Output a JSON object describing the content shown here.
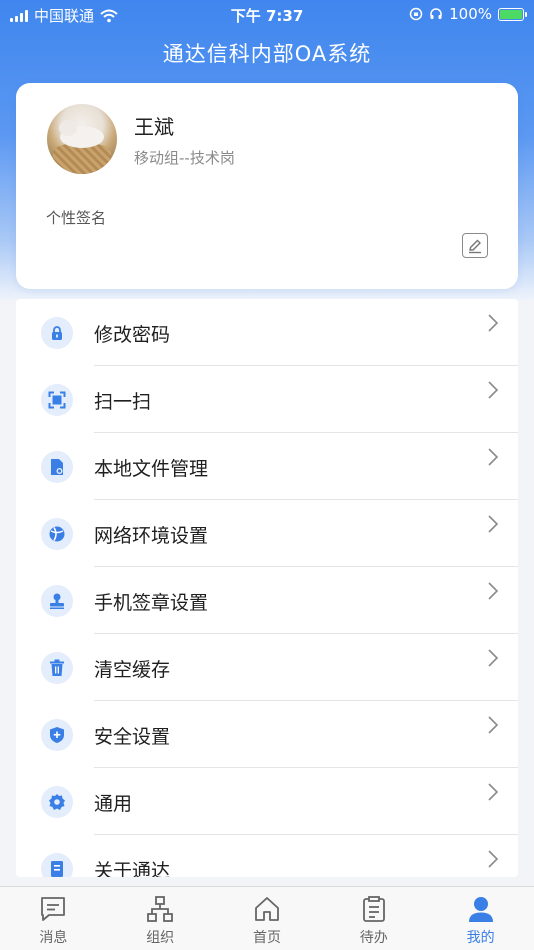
{
  "status_bar": {
    "carrier": "中国联通",
    "time": "下午 7:37",
    "battery": "100%",
    "battery_level": 1.0
  },
  "header": {
    "title": "通达信科内部OA系统"
  },
  "profile": {
    "name": "王斌",
    "department": "移动组--技术岗",
    "signature_label": "个性签名"
  },
  "menu": [
    {
      "label": "修改密码",
      "icon": "lock-icon"
    },
    {
      "label": "扫一扫",
      "icon": "scan-icon"
    },
    {
      "label": "本地文件管理",
      "icon": "file-icon"
    },
    {
      "label": "网络环境设置",
      "icon": "network-icon"
    },
    {
      "label": "手机签章设置",
      "icon": "stamp-icon"
    },
    {
      "label": "清空缓存",
      "icon": "trash-icon"
    },
    {
      "label": "安全设置",
      "icon": "shield-icon"
    },
    {
      "label": "通用",
      "icon": "gear-icon"
    },
    {
      "label": "关于通达",
      "icon": "info-doc-icon"
    }
  ],
  "tabs": [
    {
      "label": "消息",
      "icon": "message-icon",
      "active": false
    },
    {
      "label": "组织",
      "icon": "org-icon",
      "active": false
    },
    {
      "label": "首页",
      "icon": "home-icon",
      "active": false
    },
    {
      "label": "待办",
      "icon": "clipboard-icon",
      "active": false
    },
    {
      "label": "我的",
      "icon": "user-icon",
      "active": true
    }
  ],
  "colors": {
    "accent": "#3a7fe6",
    "header_blue": "#3f86ee",
    "icon_bg": "#e3edfb"
  }
}
